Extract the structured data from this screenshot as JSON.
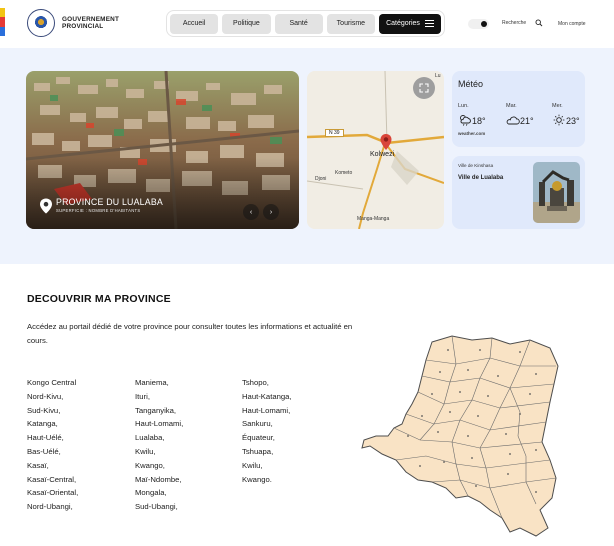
{
  "header": {
    "brand_line1": "GOUVERNEMENT",
    "brand_line2": "PROVINCIAL",
    "nav": [
      "Accueil",
      "Politique",
      "Santé",
      "Tourisme"
    ],
    "categories_label": "Catégories",
    "search_label": "Recherche",
    "account_label": "Mon compte"
  },
  "flag_colors": [
    "#f2c413",
    "#e63a35",
    "#2a6fdb"
  ],
  "hero": {
    "title": "PROVINCE DU LUALABA",
    "subtitle": "SUPERFICIE : NOMBRE D'HABITANTS"
  },
  "map": {
    "labels": {
      "road": "N 39",
      "city": "Kolwezi",
      "kometo": "Kometo",
      "djoni": "Djoni",
      "manga": "Manga-Manga",
      "corner": "Lu"
    }
  },
  "weather": {
    "title": "Météo",
    "days": [
      {
        "day": "Lun.",
        "temp": "18°",
        "icon": "partly-cloudy-rain-icon"
      },
      {
        "day": "Mar.",
        "temp": "21°",
        "icon": "cloud-icon"
      },
      {
        "day": "Mer.",
        "temp": "23°",
        "icon": "sun-icon"
      }
    ],
    "source": "weather.com"
  },
  "city_card": {
    "small": "Ville de Kinshasa",
    "name": "Ville de Lualaba"
  },
  "discover": {
    "title": "DECOUVRIR MA PROVINCE",
    "intro": "Accédez au portail dédié de votre province pour consulter toutes les informations et actualité en cours.",
    "col1": [
      "Kongo Central",
      "Nord-Kivu,",
      "Sud-Kivu,",
      "Katanga,",
      "Haut-Uélé,",
      "Bas-Uélé,",
      "Kasaï,",
      "Kasaï-Central,",
      "Kasaï-Oriental,",
      "Nord-Ubangi,"
    ],
    "col2": [
      "Maniema,",
      "Ituri,",
      "Tanganyika,",
      "Haut-Lomami,",
      "Lualaba,",
      "Kwilu,",
      "Kwango,",
      "Maï-Ndombe,",
      "Mongala,",
      "Sud-Ubangi,"
    ],
    "col3": [
      "Tshopo,",
      "Haut-Katanga,",
      "Haut-Lomami,",
      "Sankuru,",
      "Équateur,",
      "Tshuapa,",
      "Kwilu,",
      "Kwango."
    ]
  }
}
